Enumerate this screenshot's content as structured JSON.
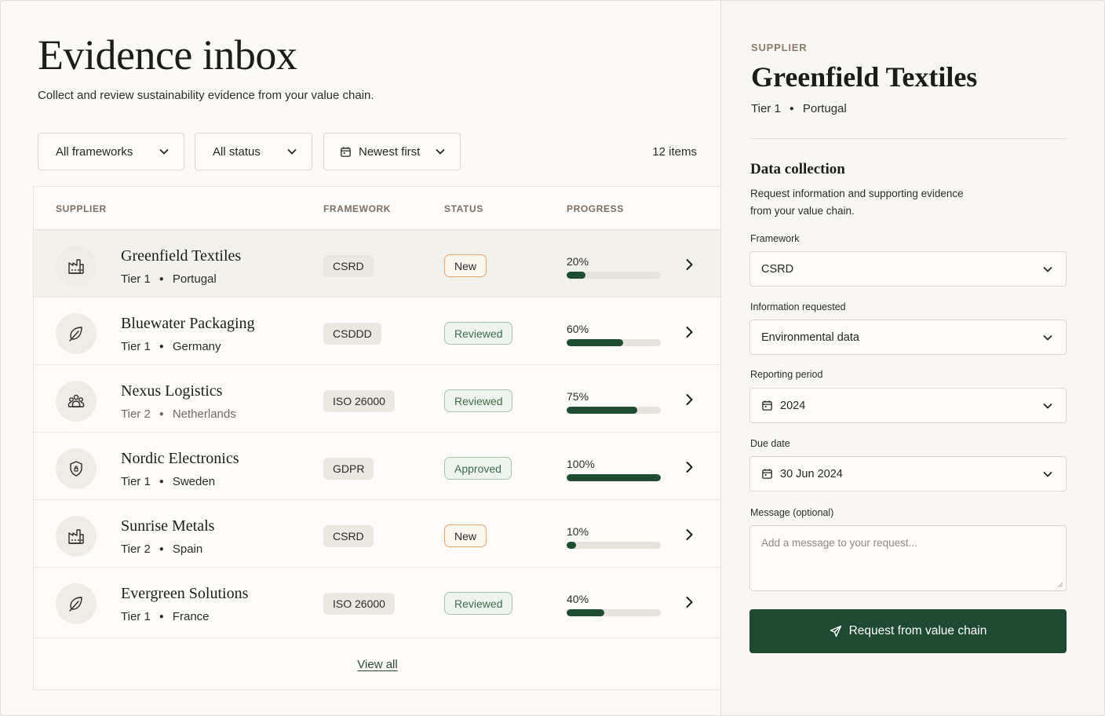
{
  "header": {
    "title": "Evidence inbox",
    "subtitle": "Collect and review sustainability evidence from your value chain."
  },
  "filters": {
    "framework": "All frameworks",
    "status": "All status",
    "sort": "Newest first",
    "count": "12 items"
  },
  "table": {
    "columns": [
      "SUPPLIER",
      "FRAMEWORK",
      "STATUS",
      "PROGRESS"
    ],
    "rows": [
      {
        "name": "Greenfield Textiles",
        "tier": "Tier 1",
        "country": "Portugal",
        "framework": "CSRD",
        "status": "New",
        "progress_label": "20%",
        "progress": 0.2,
        "icon": "factory-icon"
      },
      {
        "name": "Bluewater Packaging",
        "tier": "Tier 1",
        "country": "Germany",
        "framework": "CSDDD",
        "status": "Reviewed",
        "progress_label": "60%",
        "progress": 0.6,
        "icon": "leaf-icon"
      },
      {
        "name": "Nexus Logistics",
        "tier": "Tier 2",
        "country": "Netherlands",
        "framework": "ISO 26000",
        "status": "Reviewed",
        "progress_label": "75%",
        "progress": 0.75,
        "icon": "people-icon"
      },
      {
        "name": "Nordic Electronics",
        "tier": "Tier 1",
        "country": "Sweden",
        "framework": "GDPR",
        "status": "Approved",
        "progress_label": "100%",
        "progress": 1.0,
        "icon": "shield-icon"
      },
      {
        "name": "Sunrise Metals",
        "tier": "Tier 2",
        "country": "Spain",
        "framework": "CSRD",
        "status": "New",
        "progress_label": "10%",
        "progress": 0.1,
        "icon": "factory-icon"
      },
      {
        "name": "Evergreen Solutions",
        "tier": "Tier 1",
        "country": "France",
        "framework": "ISO 26000",
        "status": "Reviewed",
        "progress_label": "40%",
        "progress": 0.4,
        "icon": "leaf-icon"
      }
    ],
    "view_all": "View all"
  },
  "panel": {
    "eyebrow": "SUPPLIER",
    "supplier_name": "Greenfield Textiles",
    "tier": "Tier 1",
    "country": "Portugal",
    "section_title": "Data collection",
    "section_desc": "Request information and supporting evidence from your value chain.",
    "framework_label": "Framework",
    "framework_value": "CSRD",
    "info_label": "Information requested",
    "info_value": "Environmental data",
    "period_label": "Reporting period",
    "period_value": "2024",
    "due_label": "Due date",
    "due_value": "30 Jun 2024",
    "message_label": "Message (optional)",
    "message_placeholder": "Add a message to your request...",
    "cta_label": "Request from value chain"
  },
  "colors": {
    "accent": "#1f4a32",
    "new_border": "#e9a56a",
    "reviewed_border": "#a9c3ad",
    "reviewed_text": "#3f6b4a"
  }
}
